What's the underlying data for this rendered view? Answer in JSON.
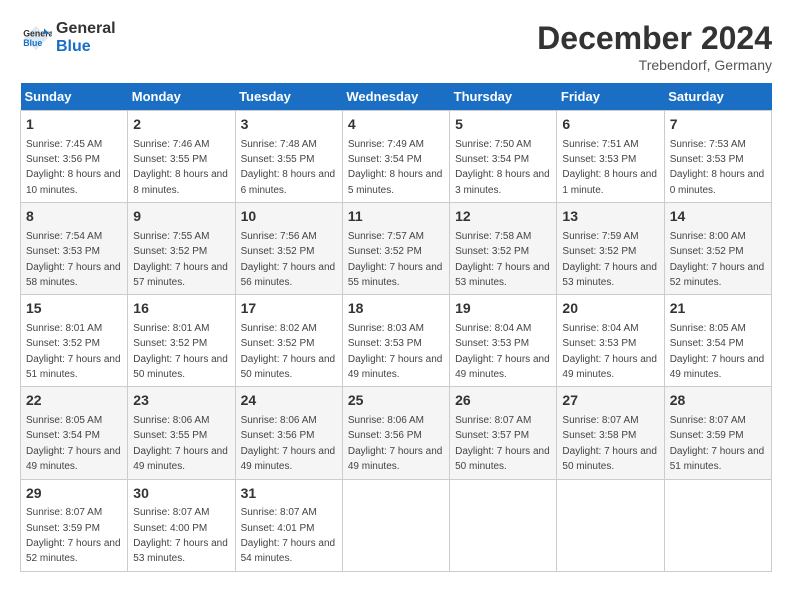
{
  "header": {
    "logo_line1": "General",
    "logo_line2": "Blue",
    "month": "December 2024",
    "location": "Trebendorf, Germany"
  },
  "weekdays": [
    "Sunday",
    "Monday",
    "Tuesday",
    "Wednesday",
    "Thursday",
    "Friday",
    "Saturday"
  ],
  "weeks": [
    [
      {
        "day": 1,
        "rise": "7:45 AM",
        "set": "3:56 PM",
        "daylight": "8 hours and 10 minutes."
      },
      {
        "day": 2,
        "rise": "7:46 AM",
        "set": "3:55 PM",
        "daylight": "8 hours and 8 minutes."
      },
      {
        "day": 3,
        "rise": "7:48 AM",
        "set": "3:55 PM",
        "daylight": "8 hours and 6 minutes."
      },
      {
        "day": 4,
        "rise": "7:49 AM",
        "set": "3:54 PM",
        "daylight": "8 hours and 5 minutes."
      },
      {
        "day": 5,
        "rise": "7:50 AM",
        "set": "3:54 PM",
        "daylight": "8 hours and 3 minutes."
      },
      {
        "day": 6,
        "rise": "7:51 AM",
        "set": "3:53 PM",
        "daylight": "8 hours and 1 minute."
      },
      {
        "day": 7,
        "rise": "7:53 AM",
        "set": "3:53 PM",
        "daylight": "8 hours and 0 minutes."
      }
    ],
    [
      {
        "day": 8,
        "rise": "7:54 AM",
        "set": "3:53 PM",
        "daylight": "7 hours and 58 minutes."
      },
      {
        "day": 9,
        "rise": "7:55 AM",
        "set": "3:52 PM",
        "daylight": "7 hours and 57 minutes."
      },
      {
        "day": 10,
        "rise": "7:56 AM",
        "set": "3:52 PM",
        "daylight": "7 hours and 56 minutes."
      },
      {
        "day": 11,
        "rise": "7:57 AM",
        "set": "3:52 PM",
        "daylight": "7 hours and 55 minutes."
      },
      {
        "day": 12,
        "rise": "7:58 AM",
        "set": "3:52 PM",
        "daylight": "7 hours and 53 minutes."
      },
      {
        "day": 13,
        "rise": "7:59 AM",
        "set": "3:52 PM",
        "daylight": "7 hours and 53 minutes."
      },
      {
        "day": 14,
        "rise": "8:00 AM",
        "set": "3:52 PM",
        "daylight": "7 hours and 52 minutes."
      }
    ],
    [
      {
        "day": 15,
        "rise": "8:01 AM",
        "set": "3:52 PM",
        "daylight": "7 hours and 51 minutes."
      },
      {
        "day": 16,
        "rise": "8:01 AM",
        "set": "3:52 PM",
        "daylight": "7 hours and 50 minutes."
      },
      {
        "day": 17,
        "rise": "8:02 AM",
        "set": "3:52 PM",
        "daylight": "7 hours and 50 minutes."
      },
      {
        "day": 18,
        "rise": "8:03 AM",
        "set": "3:53 PM",
        "daylight": "7 hours and 49 minutes."
      },
      {
        "day": 19,
        "rise": "8:04 AM",
        "set": "3:53 PM",
        "daylight": "7 hours and 49 minutes."
      },
      {
        "day": 20,
        "rise": "8:04 AM",
        "set": "3:53 PM",
        "daylight": "7 hours and 49 minutes."
      },
      {
        "day": 21,
        "rise": "8:05 AM",
        "set": "3:54 PM",
        "daylight": "7 hours and 49 minutes."
      }
    ],
    [
      {
        "day": 22,
        "rise": "8:05 AM",
        "set": "3:54 PM",
        "daylight": "7 hours and 49 minutes."
      },
      {
        "day": 23,
        "rise": "8:06 AM",
        "set": "3:55 PM",
        "daylight": "7 hours and 49 minutes."
      },
      {
        "day": 24,
        "rise": "8:06 AM",
        "set": "3:56 PM",
        "daylight": "7 hours and 49 minutes."
      },
      {
        "day": 25,
        "rise": "8:06 AM",
        "set": "3:56 PM",
        "daylight": "7 hours and 49 minutes."
      },
      {
        "day": 26,
        "rise": "8:07 AM",
        "set": "3:57 PM",
        "daylight": "7 hours and 50 minutes."
      },
      {
        "day": 27,
        "rise": "8:07 AM",
        "set": "3:58 PM",
        "daylight": "7 hours and 50 minutes."
      },
      {
        "day": 28,
        "rise": "8:07 AM",
        "set": "3:59 PM",
        "daylight": "7 hours and 51 minutes."
      }
    ],
    [
      {
        "day": 29,
        "rise": "8:07 AM",
        "set": "3:59 PM",
        "daylight": "7 hours and 52 minutes."
      },
      {
        "day": 30,
        "rise": "8:07 AM",
        "set": "4:00 PM",
        "daylight": "7 hours and 53 minutes."
      },
      {
        "day": 31,
        "rise": "8:07 AM",
        "set": "4:01 PM",
        "daylight": "7 hours and 54 minutes."
      },
      null,
      null,
      null,
      null
    ]
  ]
}
